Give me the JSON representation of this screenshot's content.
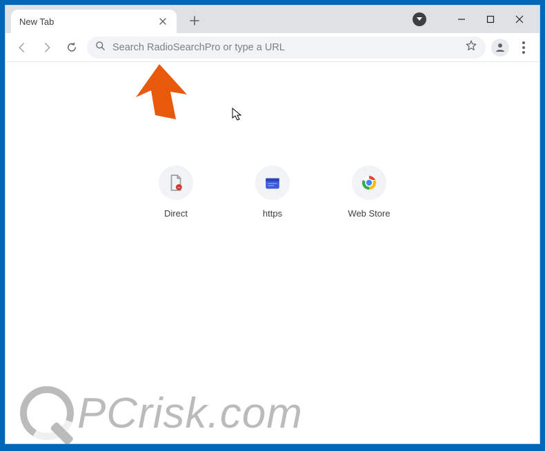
{
  "tab": {
    "title": "New Tab"
  },
  "omnibox": {
    "placeholder": "Search RadioSearchPro or type a URL"
  },
  "shortcuts": [
    {
      "label": "Direct",
      "icon": "file"
    },
    {
      "label": "https",
      "icon": "wallet"
    },
    {
      "label": "Web Store",
      "icon": "chrome"
    }
  ],
  "watermark": {
    "text": "PCrisk.com"
  }
}
